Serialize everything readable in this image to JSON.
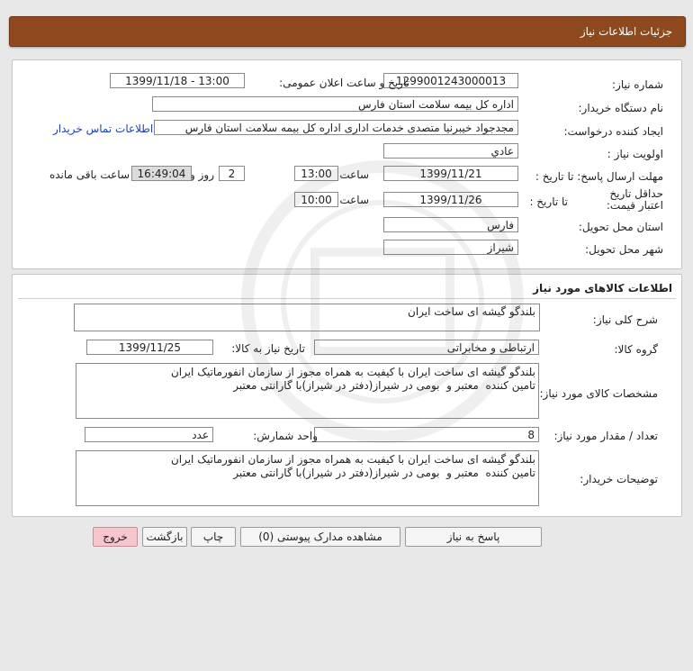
{
  "header": {
    "title": "جزئیات اطلاعات نیاز"
  },
  "info": {
    "need_number_label": "شماره نیاز:",
    "need_number": "1299001243000013",
    "announce_label": "تاریخ و ساعت اعلان عمومی:",
    "announce_value": "1399/11/18 - 13:00",
    "buyer_label": "نام دستگاه خریدار:",
    "buyer": "اداره کل بیمه سلامت استان فارس",
    "creator_label": "ایجاد کننده درخواست:",
    "creator": "مجدجواد خیبرنیا متصدی خدمات اداری اداره کل بیمه سلامت استان فارس",
    "contact_link": "اطلاعات تماس خریدار",
    "priority_label": "اولویت نیاز :",
    "priority": "عادي",
    "deadline_label": "مهلت ارسال پاسخ: تا تاریخ :",
    "deadline_date": "1399/11/21",
    "time_label": "ساعت",
    "deadline_time": "13:00",
    "days_value": "2",
    "days_label": "روز و",
    "remaining_time": "16:49:04",
    "remaining_label": "ساعت باقی مانده",
    "validity_label": "حداقل تاریخ اعتبار قیمت:",
    "validity_to_label": "تا تاریخ :",
    "validity_date": "1399/11/26",
    "validity_time_label": "ساعت",
    "validity_time": "10:00",
    "province_label": "استان محل تحویل:",
    "province": "فارس",
    "city_label": "شهر محل تحویل:",
    "city": "شیراز"
  },
  "goods": {
    "section_title": "اطلاعات کالاهای مورد نیاز",
    "description_label": "شرح کلی نیاز:",
    "description": "بلندگو گیشه ای ساخت ایران",
    "group_label": "گروه کالا:",
    "group": "ارتباطی و مخابراتی",
    "need_date_label": "تاریخ نیاز به کالا:",
    "need_date": "1399/11/25",
    "spec_label": "مشخصات کالای مورد نیاز:",
    "spec": "بلندگو گیشه ای ساخت ایران با کیفیت به همراه مجوز از سازمان انفورماتیک ایران\nتامین کننده  معتبر و  بومی در شیراز(دفتر در شیراز)با گارانتی معتبر",
    "qty_label": "تعداد / مقدار مورد نیاز:",
    "qty": "8",
    "unit_label": "واحد شمارش:",
    "unit": "عدد",
    "buyer_notes_label": "توضیحات خریدار:",
    "buyer_notes": "بلندگو گیشه ای ساخت ایران با کیفیت به همراه مجوز از سازمان انفورماتیک ایران\nتامین کننده  معتبر و  بومی در شیراز(دفتر در شیراز)با گارانتی معتبر"
  },
  "buttons": {
    "reply": "پاسخ به نیاز",
    "attachments": "مشاهده مدارک پیوستی (0)",
    "print": "چاپ",
    "back": "بازگشت",
    "exit": "خروج"
  },
  "colors": {
    "header_bg": "#8e4a1e",
    "link": "#1a3fb8",
    "exit_btn": "#f6c6cc"
  }
}
